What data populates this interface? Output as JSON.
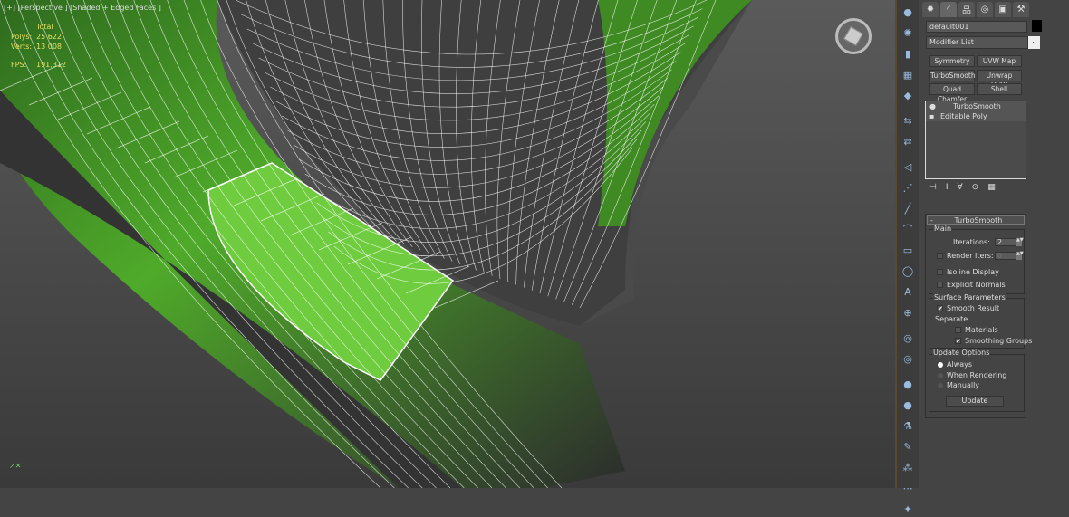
{
  "viewport": {
    "label": "[+] [Perspective ] [Shaded + Edged Faces ]",
    "stats": {
      "header": "Total",
      "polys_label": "Polys:",
      "polys": "25 622",
      "verts_label": "Verts:",
      "verts": "13 008",
      "fps_label": "FPS:",
      "fps": "191,312"
    },
    "colors": {
      "mesh": "#4faa2a",
      "background": "#4a4a4a",
      "wire": "#ffffff",
      "side": "#333333"
    }
  },
  "command_bar": {
    "icons": [
      "sphere-icon",
      "geosphere-icon",
      "cylinder-icon",
      "grid-icon",
      "box-icon",
      "link-icon",
      "unlink-icon",
      "select-icon",
      "spacewarp-icon",
      "line-icon",
      "lasso-icon",
      "region-icon",
      "circle-icon",
      "text-icon",
      "crosshair-icon",
      "snap-icon",
      "snap-toggle-icon",
      "material-icon",
      "render-icon",
      "transform-icon",
      "paint-icon",
      "xyz-icon",
      "array-icon",
      "tools-icon"
    ]
  },
  "panel": {
    "tabs": [
      "create-tab",
      "modify-tab",
      "hierarchy-tab",
      "motion-tab",
      "display-tab",
      "utilities-tab"
    ],
    "object_name": "default001",
    "modifier_list": "Modifier List",
    "modifier_buttons": [
      "Symmetry",
      "UVW Map",
      "TurboSmooth",
      "Unwrap UVW",
      "Quad Chamfer",
      "Shell"
    ],
    "stack": [
      "TurboSmooth",
      "Editable Poly"
    ],
    "rollout": {
      "title": "TurboSmooth",
      "collapse": "-",
      "main": {
        "title": "Main",
        "iterations_label": "Iterations:",
        "iterations": "2",
        "render_iters_label": "Render Iters:",
        "render_iters": "0",
        "render_iters_checked": false,
        "isoline_label": "Isoline Display",
        "isoline_checked": false,
        "explicit_label": "Explicit Normals",
        "explicit_checked": false
      },
      "surface": {
        "title": "Surface Parameters",
        "smooth_label": "Smooth Result",
        "smooth_checked": true,
        "separate_label": "Separate",
        "materials_label": "Materials",
        "materials_checked": false,
        "smoothing_label": "Smoothing Groups",
        "smoothing_checked": true
      },
      "update": {
        "title": "Update Options",
        "options": [
          "Always",
          "When Rendering",
          "Manually"
        ],
        "selected": "Always",
        "button": "Update"
      }
    }
  }
}
